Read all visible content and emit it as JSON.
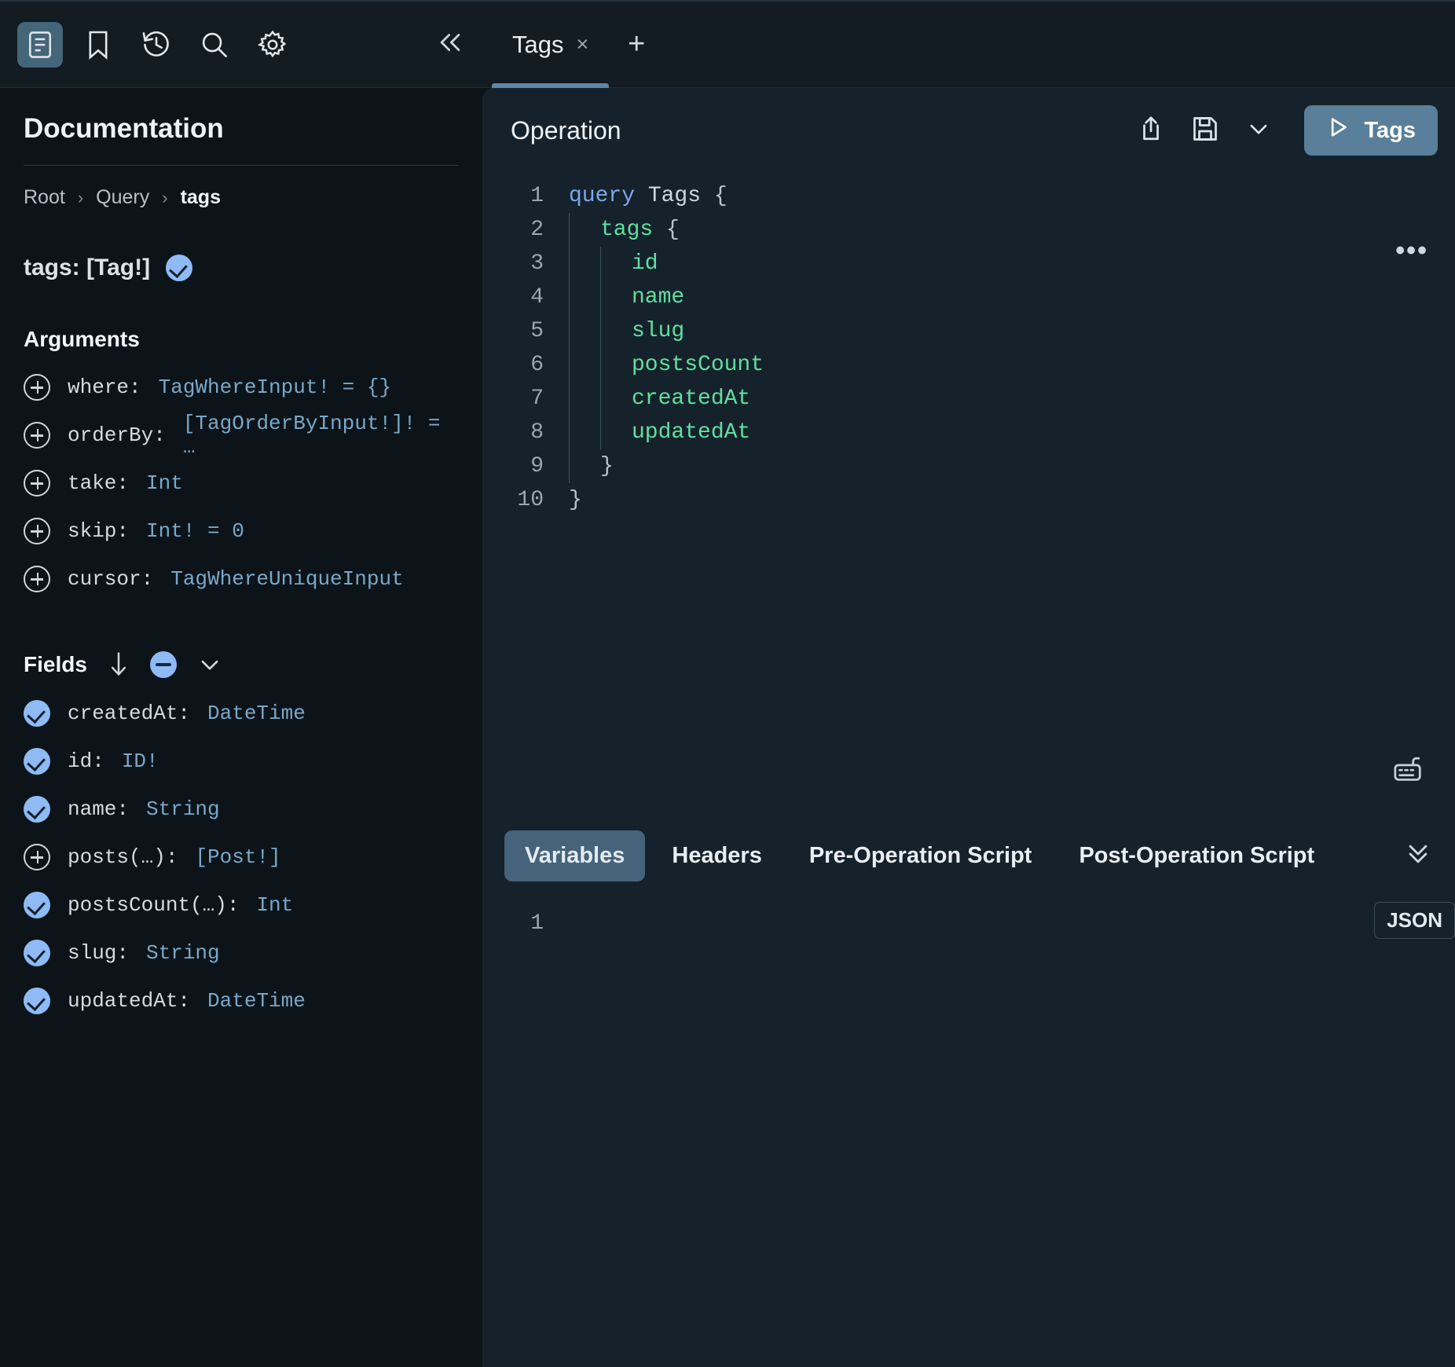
{
  "toolbar": {
    "icons": [
      {
        "name": "docs-icon",
        "label": "Documentation",
        "active": true
      },
      {
        "name": "bookmark-icon",
        "label": "Collections",
        "active": false
      },
      {
        "name": "history-icon",
        "label": "History",
        "active": false
      },
      {
        "name": "search-icon",
        "label": "Search",
        "active": false
      },
      {
        "name": "settings-icon",
        "label": "Settings",
        "active": false
      }
    ],
    "collapse_label": "«"
  },
  "tabs": {
    "items": [
      {
        "label": "Tags",
        "close": "×",
        "active": true
      }
    ],
    "new_tab_label": "+"
  },
  "docs": {
    "title": "Documentation",
    "breadcrumb": [
      "Root",
      "Query",
      "tags"
    ],
    "breadcrumb_sep": "›",
    "field_signature": "tags: [Tag!]",
    "arguments_heading": "Arguments",
    "arguments": [
      {
        "name": "where:",
        "type": "TagWhereInput! = {}",
        "state": "plus"
      },
      {
        "name": "orderBy:",
        "type": "[TagOrderByInput!]! = …",
        "state": "plus"
      },
      {
        "name": "take:",
        "type": "Int",
        "state": "plus"
      },
      {
        "name": "skip:",
        "type": "Int! = 0",
        "state": "plus"
      },
      {
        "name": "cursor:",
        "type": "TagWhereUniqueInput",
        "state": "plus"
      }
    ],
    "fields_heading": "Fields",
    "fields": [
      {
        "name": "createdAt:",
        "type": "DateTime",
        "state": "check"
      },
      {
        "name": "id:",
        "type": "ID!",
        "state": "check"
      },
      {
        "name": "name:",
        "type": "String",
        "state": "check"
      },
      {
        "name": "posts(…):",
        "type": "[Post!]",
        "state": "plus"
      },
      {
        "name": "postsCount(…):",
        "type": "Int",
        "state": "check"
      },
      {
        "name": "slug:",
        "type": "String",
        "state": "check"
      },
      {
        "name": "updatedAt:",
        "type": "DateTime",
        "state": "check"
      }
    ]
  },
  "operation": {
    "title": "Operation",
    "share_label": "Share",
    "save_label": "Save",
    "more_label": "⌄",
    "run_label": "Tags",
    "run_glyph": "▷",
    "more_dots": "•••",
    "code_lines": [
      {
        "no": "1",
        "indent": 0,
        "parts": [
          {
            "t": "query ",
            "c": "kw"
          },
          {
            "t": "Tags ",
            "c": "opname"
          },
          {
            "t": "{",
            "c": "punc"
          }
        ]
      },
      {
        "no": "2",
        "indent": 1,
        "parts": [
          {
            "t": "tags ",
            "c": "fieldname"
          },
          {
            "t": "{",
            "c": "punc"
          }
        ]
      },
      {
        "no": "3",
        "indent": 2,
        "parts": [
          {
            "t": "id",
            "c": "fieldname"
          }
        ]
      },
      {
        "no": "4",
        "indent": 2,
        "parts": [
          {
            "t": "name",
            "c": "fieldname"
          }
        ]
      },
      {
        "no": "5",
        "indent": 2,
        "parts": [
          {
            "t": "slug",
            "c": "fieldname"
          }
        ]
      },
      {
        "no": "6",
        "indent": 2,
        "parts": [
          {
            "t": "postsCount",
            "c": "fieldname"
          }
        ]
      },
      {
        "no": "7",
        "indent": 2,
        "parts": [
          {
            "t": "createdAt",
            "c": "fieldname"
          }
        ]
      },
      {
        "no": "8",
        "indent": 2,
        "parts": [
          {
            "t": "updatedAt",
            "c": "fieldname"
          }
        ]
      },
      {
        "no": "9",
        "indent": 1,
        "parts": [
          {
            "t": "}",
            "c": "punc"
          }
        ]
      },
      {
        "no": "10",
        "indent": 0,
        "parts": [
          {
            "t": "}",
            "c": "punc"
          }
        ]
      }
    ]
  },
  "variables": {
    "tabs": [
      {
        "label": "Variables",
        "active": true
      },
      {
        "label": "Headers",
        "active": false
      },
      {
        "label": "Pre-Operation Script",
        "active": false
      },
      {
        "label": "Post-Operation Script",
        "active": false
      }
    ],
    "collapse_label": "⌄⌄",
    "line_numbers": [
      "1"
    ],
    "content": "",
    "format_badge": "JSON"
  },
  "colors": {
    "accent": "#5a7f9a",
    "check": "#8ebbf5",
    "keyword": "#7fa6ea",
    "field": "#5fe0a0",
    "type": "#79a8c9",
    "panel_bg": "#16222b",
    "app_bg": "#0d1419"
  }
}
